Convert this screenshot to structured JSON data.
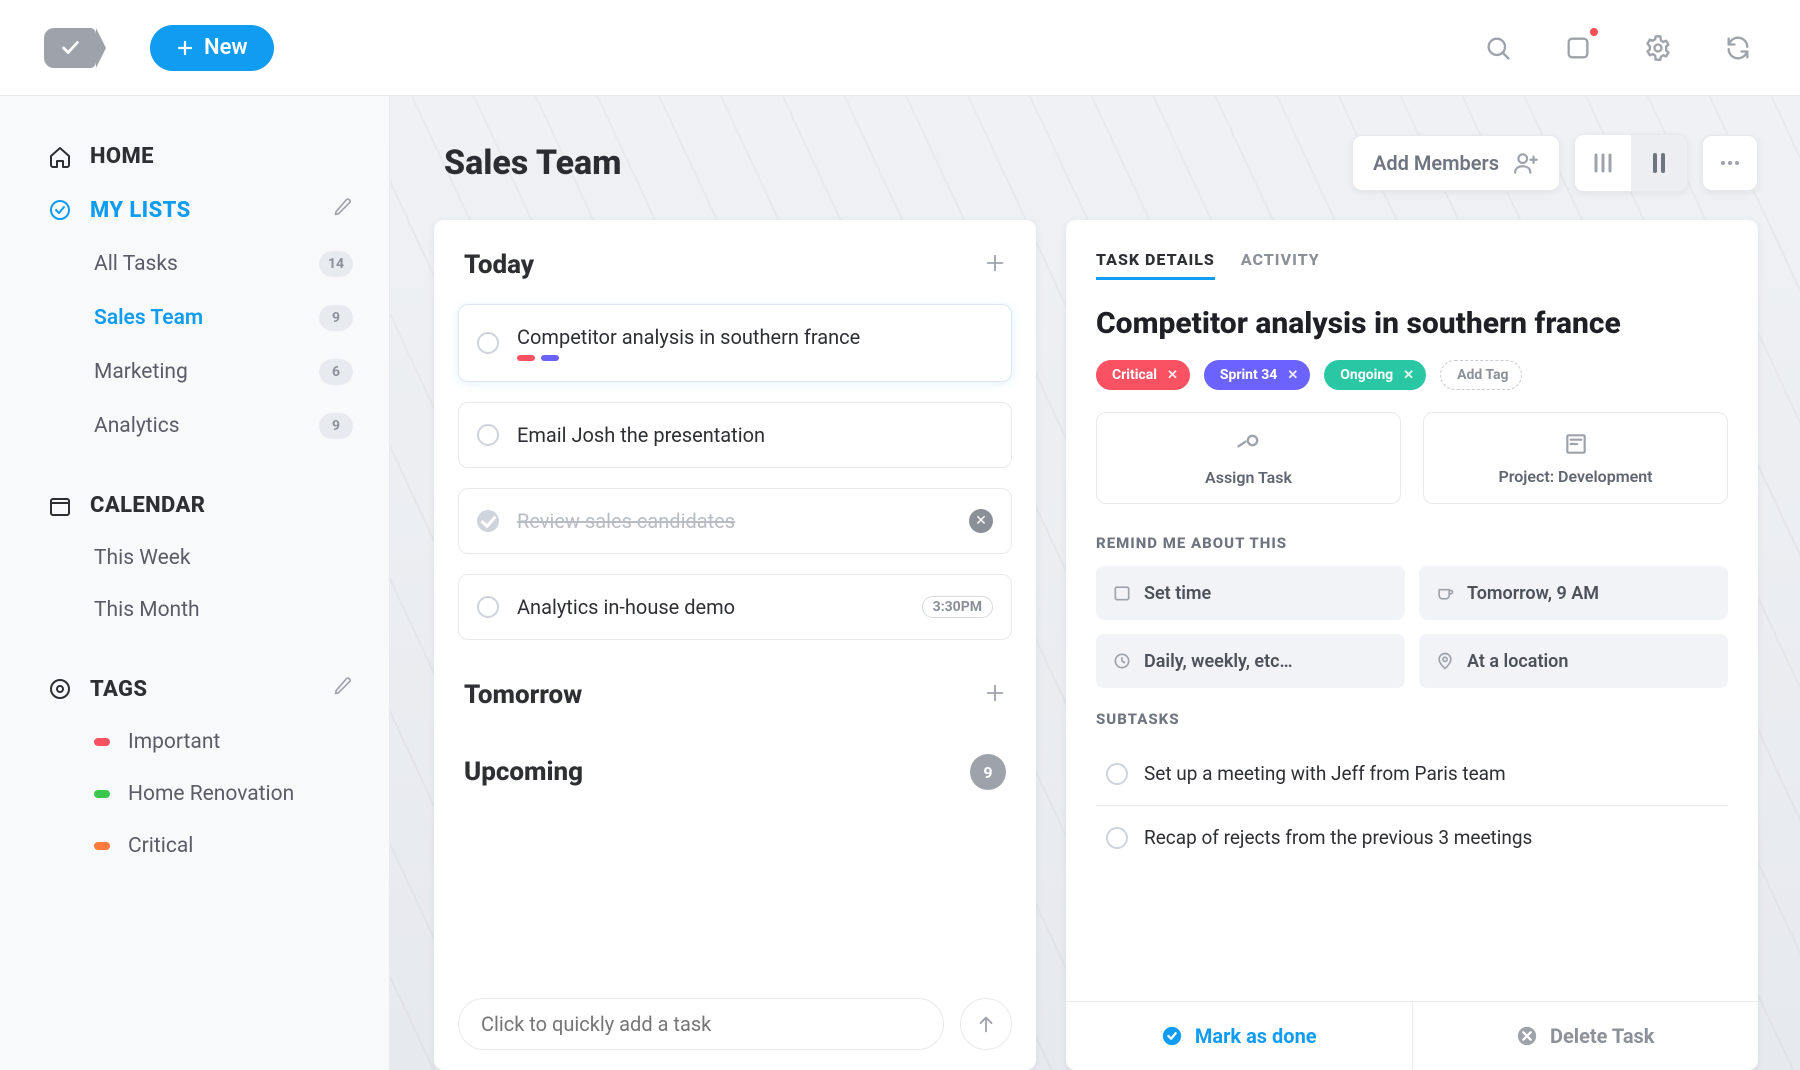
{
  "topbar": {
    "new_label": "New"
  },
  "sidebar": {
    "home_label": "HOME",
    "mylists_label": "MY LISTS",
    "calendar_label": "CALENDAR",
    "tags_label": "TAGS",
    "lists": [
      {
        "label": "All Tasks",
        "count": "14"
      },
      {
        "label": "Sales Team",
        "count": "9"
      },
      {
        "label": "Marketing",
        "count": "6"
      },
      {
        "label": "Analytics",
        "count": "9"
      }
    ],
    "calendar_items": [
      {
        "label": "This Week"
      },
      {
        "label": "This Month"
      }
    ],
    "tag_items": [
      {
        "label": "Important",
        "color": "#FA5263"
      },
      {
        "label": "Home Renovation",
        "color": "#3BC74E"
      },
      {
        "label": "Critical",
        "color": "#FF7A3D"
      }
    ]
  },
  "page": {
    "title": "Sales Team",
    "add_members_label": "Add Members"
  },
  "list": {
    "sections": {
      "today": "Today",
      "tomorrow": "Tomorrow",
      "upcoming": "Upcoming"
    },
    "upcoming_count": "9",
    "tasks_today": [
      {
        "title": "Competitor analysis in southern france",
        "selected": true,
        "dashes": [
          "#FA5263",
          "#6C63FF"
        ]
      },
      {
        "title": "Email Josh the presentation"
      },
      {
        "title": "Review sales candidates",
        "done": true
      },
      {
        "title": "Analytics in-house demo",
        "time_pill": "3:30PM"
      }
    ],
    "quick_add_placeholder": "Click to quickly add a task"
  },
  "details": {
    "tabs": {
      "task_details": "TASK DETAILS",
      "activity": "ACTIVITY"
    },
    "title": "Competitor analysis in southern france",
    "chips": [
      {
        "label": "Critical",
        "bg": "#FA5263"
      },
      {
        "label": "Sprint 34",
        "bg": "#6C63FF"
      },
      {
        "label": "Ongoing",
        "bg": "#2AC7A5"
      }
    ],
    "add_tag": "Add Tag",
    "assign_label": "Assign Task",
    "project_label": "Project: Development",
    "remind_header": "REMIND ME ABOUT THIS",
    "reminders": [
      {
        "label": "Set time"
      },
      {
        "label": "Tomorrow, 9 AM"
      },
      {
        "label": "Daily, weekly, etc…"
      },
      {
        "label": "At a location"
      }
    ],
    "subtasks_header": "SUBTASKS",
    "subtasks": [
      {
        "label": "Set up a meeting with Jeff from Paris team"
      },
      {
        "label": "Recap of rejects from the previous 3 meetings"
      }
    ],
    "mark_done": "Mark as done",
    "delete_task": "Delete Task"
  }
}
